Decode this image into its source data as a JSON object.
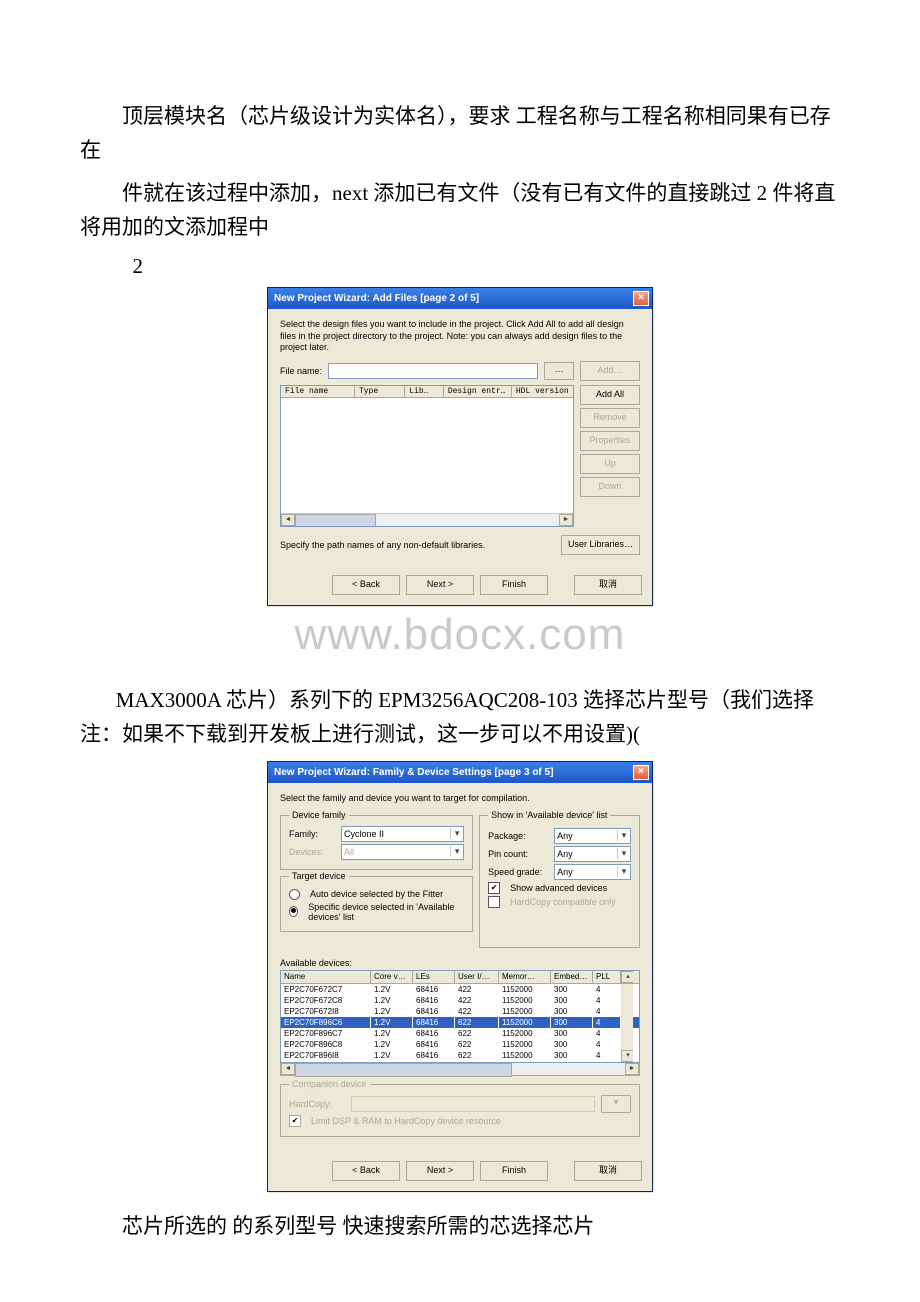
{
  "text": {
    "p1": "顶层模块名（芯片级设计为实体名），要求 工程名称与工程名称相同果有已存在",
    "p2": "件就在该过程中添加，next 添加已有文件（没有已有文件的直接跳过 2 件将直将用加的文添加程中",
    "num2": "2",
    "p3": "MAX3000A 芯片）系列下的 EPM3256AQC208-103 选择芯片型号（我们选择 注：如果不下载到开发板上进行测试，这一步可以不用设置)(",
    "p4": "芯片所选的 的系列型号 快速搜索所需的芯选择芯片"
  },
  "watermark": "www.bdocx.com",
  "dlg1": {
    "title": "New Project Wizard: Add Files [page 2 of 5]",
    "close": "×",
    "instr": "Select the design files you want to include in the project. Click Add All to add all design files in the project directory to the project. Note: you can always add design files to the project later.",
    "filename_lbl": "File name:",
    "browse": "…",
    "btns": {
      "add": "Add…",
      "addall": "Add All",
      "remove": "Remove",
      "props": "Properties",
      "up": "Up",
      "down": "Down"
    },
    "cols": {
      "file": "File name",
      "type": "Type",
      "lib": "Lib…",
      "entry": "Design entr…",
      "hdl": "HDL version"
    },
    "libnote": "Specify the path names of any non-default libraries.",
    "userlib": "User Libraries…",
    "nav": {
      "back": "< Back",
      "next": "Next >",
      "finish": "Finish",
      "cancel": "取消"
    }
  },
  "dlg2": {
    "title": "New Project Wizard: Family & Device Settings [page 3 of 5]",
    "close": "×",
    "instr": "Select the family and device you want to target for compilation.",
    "grp_family": "Device family",
    "family_lbl": "Family:",
    "family_val": "Cyclone II",
    "devices_lbl": "Devices:",
    "devices_val": "All",
    "grp_target": "Target device",
    "r_auto": "Auto device selected by the Fitter",
    "r_spec": "Specific device selected in 'Available devices' list",
    "grp_show": "Show in 'Available device' list",
    "pkg_lbl": "Package:",
    "pkg_val": "Any",
    "pin_lbl": "Pin count:",
    "pin_val": "Any",
    "spd_lbl": "Speed grade:",
    "spd_val": "Any",
    "adv_lbl": "Show advanced devices",
    "hc_lbl": "HardCopy compatible only",
    "avail_lbl": "Available devices:",
    "cols": {
      "name": "Name",
      "core": "Core v…",
      "les": "LEs",
      "io": "User I/…",
      "mem": "Memor…",
      "emb": "Embed…",
      "pll": "PLL"
    },
    "rows": [
      {
        "name": "EP2C70F672C7",
        "core": "1.2V",
        "les": "68416",
        "io": "422",
        "mem": "1152000",
        "emb": "300",
        "pll": "4"
      },
      {
        "name": "EP2C70F672C8",
        "core": "1.2V",
        "les": "68416",
        "io": "422",
        "mem": "1152000",
        "emb": "300",
        "pll": "4"
      },
      {
        "name": "EP2C70F672I8",
        "core": "1.2V",
        "les": "68416",
        "io": "422",
        "mem": "1152000",
        "emb": "300",
        "pll": "4"
      },
      {
        "name": "EP2C70F896C6",
        "core": "1.2V",
        "les": "68416",
        "io": "622",
        "mem": "1152000",
        "emb": "300",
        "pll": "4"
      },
      {
        "name": "EP2C70F896C7",
        "core": "1.2V",
        "les": "68416",
        "io": "622",
        "mem": "1152000",
        "emb": "300",
        "pll": "4"
      },
      {
        "name": "EP2C70F896C8",
        "core": "1.2V",
        "les": "68416",
        "io": "622",
        "mem": "1152000",
        "emb": "300",
        "pll": "4"
      },
      {
        "name": "EP2C70F896I8",
        "core": "1.2V",
        "les": "68416",
        "io": "622",
        "mem": "1152000",
        "emb": "300",
        "pll": "4"
      }
    ],
    "selected_index": 3,
    "grp_comp": "Companion device",
    "hardcopy_lbl": "HardCopy:",
    "limit_lbl": "Limit DSP & RAM to HardCopy device resource",
    "nav": {
      "back": "< Back",
      "next": "Next >",
      "finish": "Finish",
      "cancel": "取消"
    }
  }
}
